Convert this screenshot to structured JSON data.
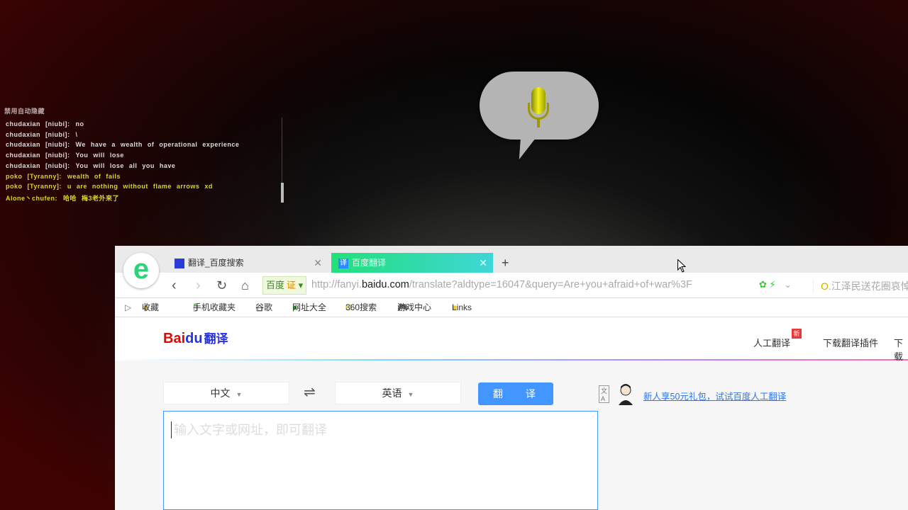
{
  "game_chat": {
    "header": "禁用自动隐藏",
    "lines": [
      {
        "name": "chudaxian [niubi]:",
        "text": "no",
        "color": "#dcdcdc"
      },
      {
        "name": "chudaxian [niubi]:",
        "text": "\\",
        "color": "#dcdcdc"
      },
      {
        "name": "chudaxian [niubi]:",
        "text": "We have a wealth of operational experience",
        "color": "#dcdcdc"
      },
      {
        "name": "chudaxian [niubi]:",
        "text": "You will lose",
        "color": "#dcdcdc"
      },
      {
        "name": "chudaxian [niubi]:",
        "text": "You will lose all you have",
        "color": "#dcdcdc"
      },
      {
        "name": "poko [Tyranny]:",
        "text": "wealth of fails",
        "color": "#d8d820"
      },
      {
        "name": "poko [Tyranny]:",
        "text": "u are nothing without flame arrows xd",
        "color": "#d8d820"
      },
      {
        "name": "Alone丶chufen:",
        "text": "哈哈 梅3老外来了",
        "color": "#d8d820"
      }
    ]
  },
  "browser": {
    "logo": "e",
    "tabs": [
      {
        "icon": "🐾",
        "label": "翻译_百度搜索"
      },
      {
        "icon": "译",
        "label": "百度翻译",
        "active": true
      }
    ],
    "new_tab": "+",
    "security_label": "百度",
    "security_badge": "证",
    "url_prefix": "http://fanyi.",
    "url_domain": "baidu.com",
    "url_rest": "/translate?aldtype=16047&query=Are+you+afraid+of+war%3F",
    "search_placeholder": "江泽民送花圈哀悼",
    "bookmarks": [
      "收藏",
      "手机收藏夹",
      "谷歌",
      "网址大全",
      "360搜索",
      "游戏中心",
      "Links"
    ]
  },
  "page": {
    "logo_bai": "Bai",
    "logo_du": "du",
    "logo_fy": "翻译",
    "links": [
      "人工翻译",
      "下载翻译插件",
      "下载"
    ],
    "new_badge": "新",
    "source_lang": "中文",
    "target_lang": "英语",
    "swap": "⇌",
    "translate_button": "翻 译",
    "promo_icon": "文A",
    "promo_text": "新人享50元礼包，试试百度人工翻译",
    "input_placeholder": "输入文字或网址，即可翻译"
  }
}
